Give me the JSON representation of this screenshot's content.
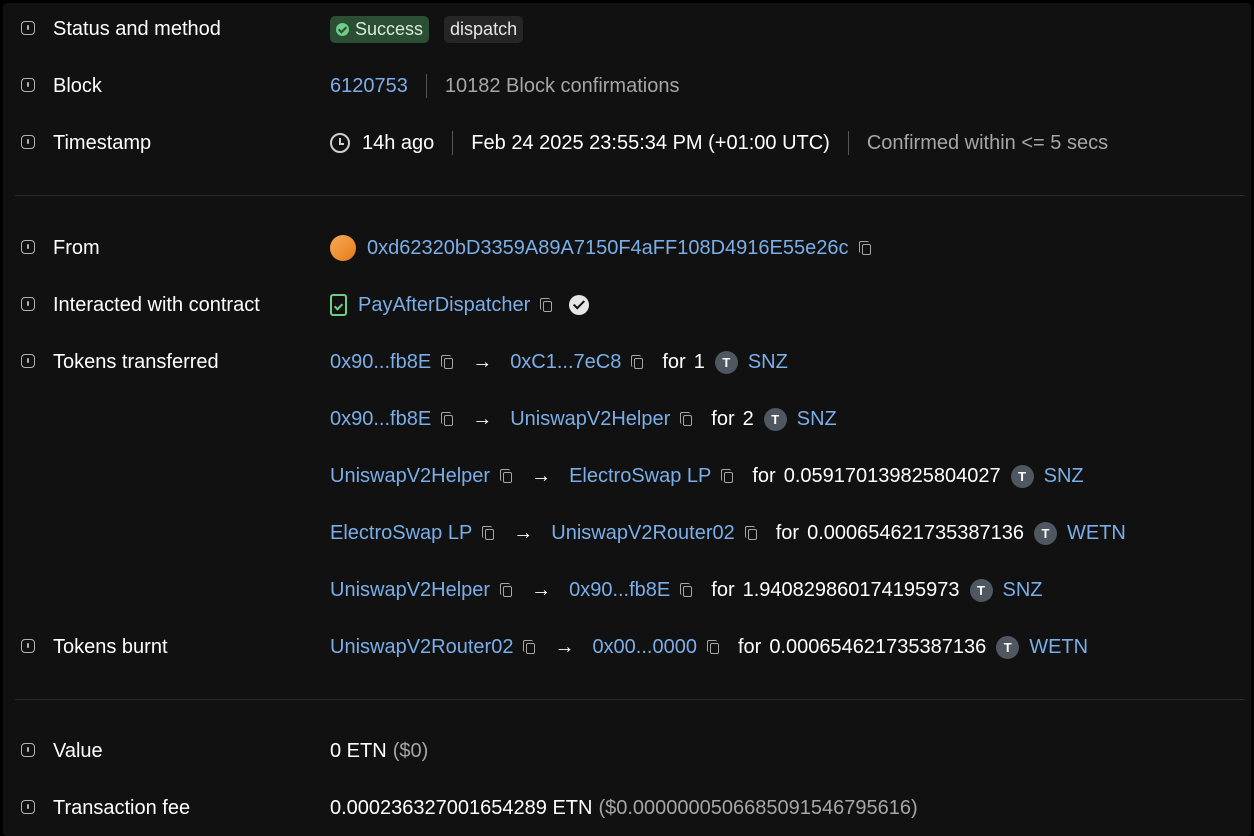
{
  "rows": {
    "status": {
      "label": "Status and method",
      "status": "Success",
      "method": "dispatch"
    },
    "block": {
      "label": "Block",
      "number": "6120753",
      "confirmations": "10182 Block confirmations"
    },
    "timestamp": {
      "label": "Timestamp",
      "ago": "14h ago",
      "datetime": "Feb 24 2025 23:55:34 PM (+01:00 UTC)",
      "confirmed": "Confirmed within <= 5 secs"
    },
    "from": {
      "label": "From",
      "address": "0xd62320bD3359A89A7150F4aFF108D4916E55e26c"
    },
    "contract": {
      "label": "Interacted with contract",
      "name": "PayAfterDispatcher"
    },
    "tokens_transferred": {
      "label": "Tokens transferred",
      "transfers": [
        {
          "from": "0x90...fb8E",
          "to": "0xC1...7eC8",
          "amount": "1",
          "token": "SNZ"
        },
        {
          "from": "0x90...fb8E",
          "to": "UniswapV2Helper",
          "amount": "2",
          "token": "SNZ"
        },
        {
          "from": "UniswapV2Helper",
          "to": "ElectroSwap LP",
          "amount": "0.059170139825804027",
          "token": "SNZ"
        },
        {
          "from": "ElectroSwap LP",
          "to": "UniswapV2Router02",
          "amount": "0.000654621735387136",
          "token": "WETN"
        },
        {
          "from": "UniswapV2Helper",
          "to": "0x90...fb8E",
          "amount": "1.940829860174195973",
          "token": "SNZ"
        }
      ]
    },
    "tokens_burnt": {
      "label": "Tokens burnt",
      "from": "UniswapV2Router02",
      "to": "0x00...0000",
      "amount": "0.000654621735387136",
      "token": "WETN"
    },
    "value": {
      "label": "Value",
      "amount": "0 ETN",
      "usd": "($0)"
    },
    "fee": {
      "label": "Transaction fee",
      "amount": "0.000236327001654289 ETN",
      "usd": "($0.0000000506685091546795616)"
    }
  },
  "common": {
    "for": "for",
    "arrow": "→",
    "token_glyph": "T"
  }
}
